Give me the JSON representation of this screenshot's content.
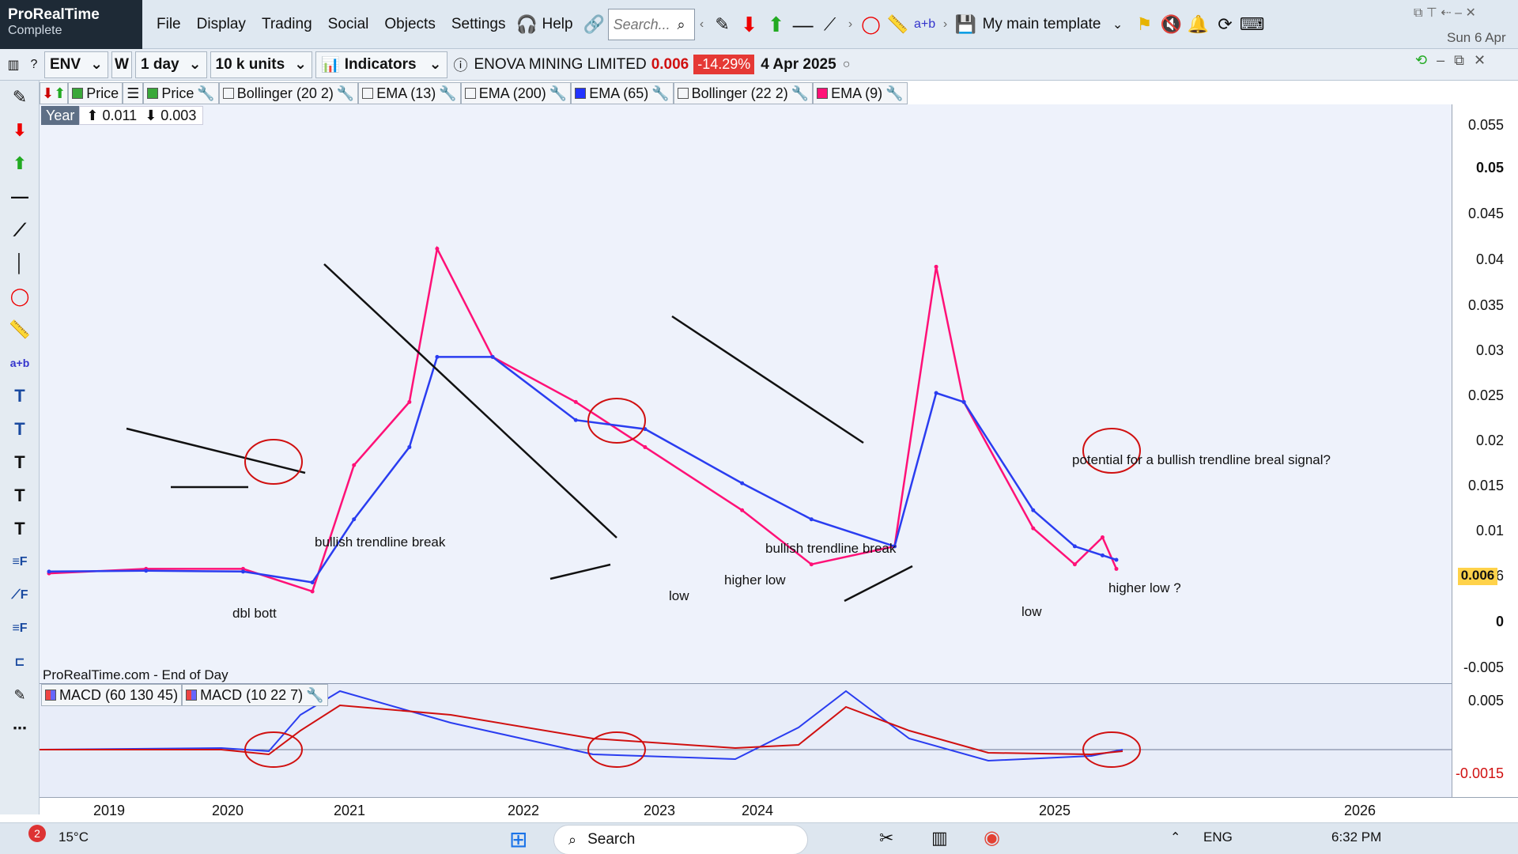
{
  "app": {
    "name": "ProRealTime",
    "edition": "Complete"
  },
  "menu": [
    "File",
    "Display",
    "Trading",
    "Social",
    "Objects",
    "Settings"
  ],
  "help_label": "Help",
  "search_placeholder": "Search...",
  "template_label": "My main template",
  "date_top": "Sun 6 Apr",
  "toolbar2": {
    "symbol": "ENV",
    "timeframe": "1 day",
    "units": "10 k units",
    "indicators": "Indicators",
    "instrument": "ENOVA MINING LIMITED",
    "price": "0.006",
    "change": "-14.29%",
    "date": "4 Apr 2025"
  },
  "indicators": [
    {
      "label": "Price",
      "color": "#3aa83a"
    },
    {
      "label": "Price",
      "color": "#3aa83a"
    },
    {
      "label": "Bollinger (20 2)",
      "color": "#ffffff"
    },
    {
      "label": "EMA (13)",
      "color": "#ffffff"
    },
    {
      "label": "EMA (200)",
      "color": "#ffffff"
    },
    {
      "label": "EMA (65)",
      "color": "#2233ff"
    },
    {
      "label": "Bollinger (22 2)",
      "color": "#ffffff"
    },
    {
      "label": "EMA (9)",
      "color": "#ff1177"
    }
  ],
  "period": {
    "label": "Year",
    "high": "0.011",
    "low": "0.003"
  },
  "footer_label": "ProRealTime.com - End of Day",
  "macd_labels": [
    "MACD (60 130 45)",
    "MACD (10 22 7)"
  ],
  "price_ticks": [
    "0.055",
    "0.05",
    "0.045",
    "0.04",
    "0.035",
    "0.03",
    "0.025",
    "0.02",
    "0.015",
    "0.01",
    "0.006",
    "0",
    "-0.005"
  ],
  "macd_ticks": [
    "0.005",
    "-0.0015"
  ],
  "x_ticks": [
    "2019",
    "2020",
    "2021",
    "2022",
    "2023",
    "2024",
    "2025",
    "2026"
  ],
  "annotations": {
    "dbl": "dbl bott",
    "break1": "bullish trendline break",
    "low1": "low",
    "higher1": "higher low",
    "break2": "bullish trendline break",
    "potential": "potential for a bullish trendline breal signal?",
    "low2": "low",
    "higher2": "higher low ?"
  },
  "taskbar": {
    "weather": "15°C",
    "search": "Search",
    "lang": "ENG",
    "time": "6:32 PM",
    "badge": "2"
  },
  "chart_data": {
    "type": "line",
    "x": [
      "2018-11",
      "2019-06",
      "2020-01",
      "2020-06",
      "2020-09",
      "2021-01",
      "2021-03",
      "2021-07",
      "2022-01",
      "2022-06",
      "2023-01",
      "2023-06",
      "2023-12",
      "2024-03",
      "2024-05",
      "2024-10",
      "2025-01",
      "2025-03",
      "2025-04"
    ],
    "series": [
      {
        "name": "EMA (9)",
        "values": [
          0.006,
          0.0065,
          0.0065,
          0.004,
          0.018,
          0.025,
          0.042,
          0.03,
          0.025,
          0.02,
          0.013,
          0.007,
          0.009,
          0.04,
          0.025,
          0.011,
          0.007,
          0.01,
          0.0065
        ]
      },
      {
        "name": "EMA (65)",
        "values": [
          0.0062,
          0.0063,
          0.0062,
          0.005,
          0.012,
          0.02,
          0.03,
          0.03,
          0.023,
          0.022,
          0.016,
          0.012,
          0.009,
          0.026,
          0.025,
          0.013,
          0.009,
          0.008,
          0.0075
        ]
      }
    ],
    "ylim": [
      -0.006,
      0.058
    ]
  }
}
